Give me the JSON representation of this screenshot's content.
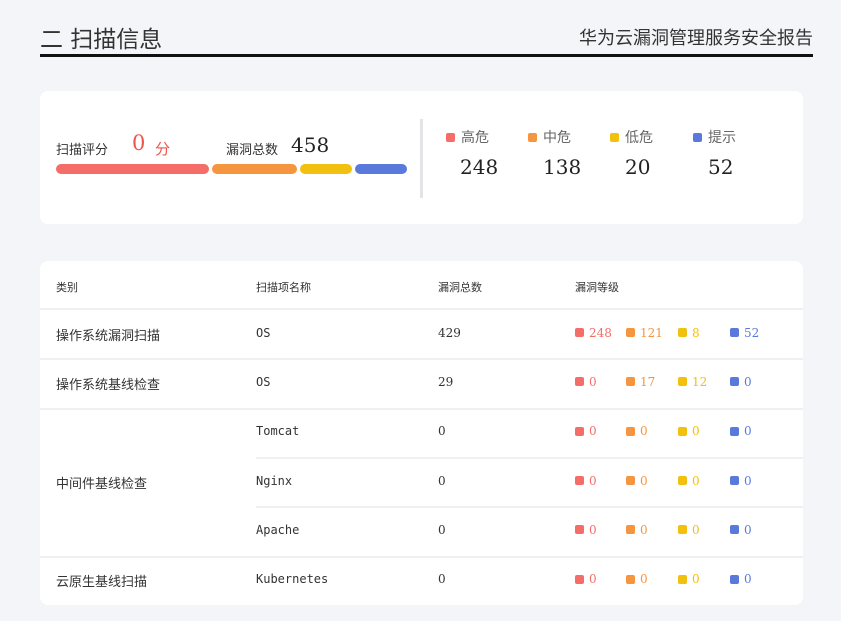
{
  "header": {
    "title": "二 扫描信息",
    "report": "华为云漏洞管理服务安全报告"
  },
  "summary": {
    "score_label": "扫描评分",
    "score_value": "0",
    "score_unit": "分",
    "total_label": "漏洞总数",
    "total_value": "458",
    "levels": [
      {
        "name": "高危",
        "value": "248",
        "color": "#f56d68"
      },
      {
        "name": "中危",
        "value": "138",
        "color": "#f5953f"
      },
      {
        "name": "低危",
        "value": "20",
        "color": "#f2c00f"
      },
      {
        "name": "提示",
        "value": "52",
        "color": "#5a7adb"
      }
    ]
  },
  "table": {
    "headers": [
      "类别",
      "扫描项名称",
      "漏洞总数",
      "漏洞等级"
    ],
    "rows": [
      {
        "category": "操作系统漏洞扫描",
        "item": "OS",
        "total": "429",
        "levels": [
          "248",
          "121",
          "8",
          "52"
        ]
      },
      {
        "category": "操作系统基线检查",
        "item": "OS",
        "total": "29",
        "levels": [
          "0",
          "17",
          "12",
          "0"
        ]
      },
      {
        "category": "中间件基线检查",
        "item": "Tomcat",
        "total": "0",
        "levels": [
          "0",
          "0",
          "0",
          "0"
        ]
      },
      {
        "category": "",
        "item": "Nginx",
        "total": "0",
        "levels": [
          "0",
          "0",
          "0",
          "0"
        ]
      },
      {
        "category": "",
        "item": "Apache",
        "total": "0",
        "levels": [
          "0",
          "0",
          "0",
          "0"
        ]
      },
      {
        "category": "云原生基线扫描",
        "item": "Kubernetes",
        "total": "0",
        "levels": [
          "0",
          "0",
          "0",
          "0"
        ]
      }
    ]
  }
}
